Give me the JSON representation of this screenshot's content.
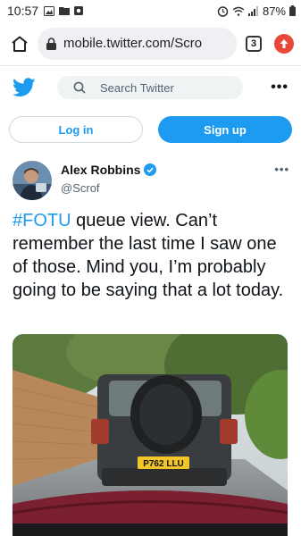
{
  "status_bar": {
    "time": "10:57",
    "battery": "87%"
  },
  "browser": {
    "url": "mobile.twitter.com/Scro",
    "tab_count": "3"
  },
  "twitter_bar": {
    "search_placeholder": "Search Twitter",
    "more_label": "•••"
  },
  "auth": {
    "login_label": "Log in",
    "signup_label": "Sign up"
  },
  "tweet": {
    "author_name": "Alex Robbins",
    "author_handle": "@Scrof",
    "hashtag": "#FOTU",
    "text": " queue view. Can’t remember the last time I saw one of those. Mind you, I’m probably going to be saying that a lot today.",
    "more_label": "•••",
    "plate_text": "P762 LLU"
  },
  "colors": {
    "accent": "#1d9bf0",
    "text": "#0f1419",
    "muted": "#536471"
  }
}
